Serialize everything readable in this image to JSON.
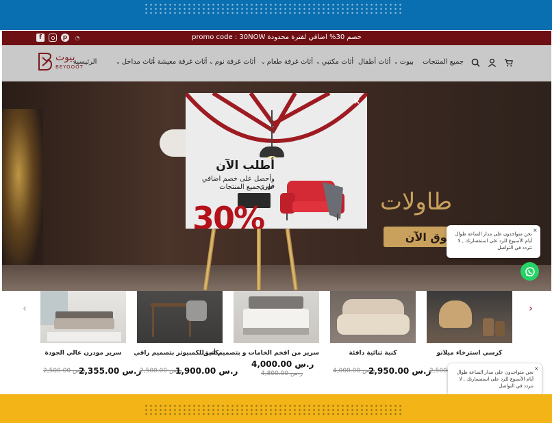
{
  "promo": {
    "text": "promo code : 30NOW حصم 30% اضافي لفترة محدودة",
    "social_icons": [
      "facebook-icon",
      "instagram-icon",
      "pinterest-icon",
      "snapchat-icon"
    ]
  },
  "header": {
    "logo_ar": "بيوت",
    "logo_en": "BEYOOOT",
    "nav": [
      {
        "label": "جميع المنتجات",
        "has_dropdown": false
      },
      {
        "label": "بيوت",
        "has_dropdown": true
      },
      {
        "label": "أثاث أطفال",
        "has_dropdown": false
      },
      {
        "label": "أثاث مكتبي",
        "has_dropdown": true
      },
      {
        "label": "أثاث غرفة طعام",
        "has_dropdown": true
      },
      {
        "label": "أثاث غرفة نوم",
        "has_dropdown": true
      },
      {
        "label": "أثاث غرفة معيشة",
        "has_dropdown": true
      },
      {
        "label": "أثاث مداخل",
        "has_dropdown": true
      },
      {
        "label": "الرئيسية",
        "has_dropdown": false
      }
    ],
    "icons": [
      "search-icon",
      "account-icon",
      "cart-icon"
    ]
  },
  "hero": {
    "title": "طاولات",
    "cta": "تسوق الآن"
  },
  "popup": {
    "close": "×",
    "heading": "أطلب الآن",
    "line1": "وأحصل على خصم اضافي فوري",
    "line2": "على جميع المنتجات",
    "discount": "30%"
  },
  "chat": {
    "message": "نحن متواجدون على مدار الساعة طوال أيام الأسبوع للرد على استفسارتك , لا تتردد في التواصل",
    "close": "×"
  },
  "products": [
    {
      "name": "كرسي استرخاء ميلانو",
      "old_price": "2,500.00 ر.س",
      "new_price": "",
      "from": ""
    },
    {
      "name": "كنبة ثنائية دافئة",
      "old_price": "4,000.00 ر.س",
      "new_price": "ر.س 2,950.00",
      "from": ""
    },
    {
      "name": "سرير من افخم الخامات و بتصميم أنيق",
      "old_price": "4,800.00 ر.س",
      "new_price": "4,000.00 ر.س",
      "from": "من"
    },
    {
      "name": "مكتب للكمبيوتر بتصميم راقي",
      "old_price": "2,500.00 ر.س",
      "new_price": "ر.س 1,900.00",
      "from": ""
    },
    {
      "name": "سرير مودرن عالي الجودة",
      "old_price": "2,500.00 ر.س",
      "new_price": "2,355.00 ر.س",
      "from": ""
    }
  ],
  "colors": {
    "frame_top": "#0a6fb0",
    "frame_bottom": "#f2b416",
    "promo_bar": "#6e0f14",
    "header": "#c9c9c9",
    "brand": "#7a1a1f",
    "gold": "#c9a15c",
    "popup_red": "#b4121b",
    "whatsapp": "#25d366"
  }
}
